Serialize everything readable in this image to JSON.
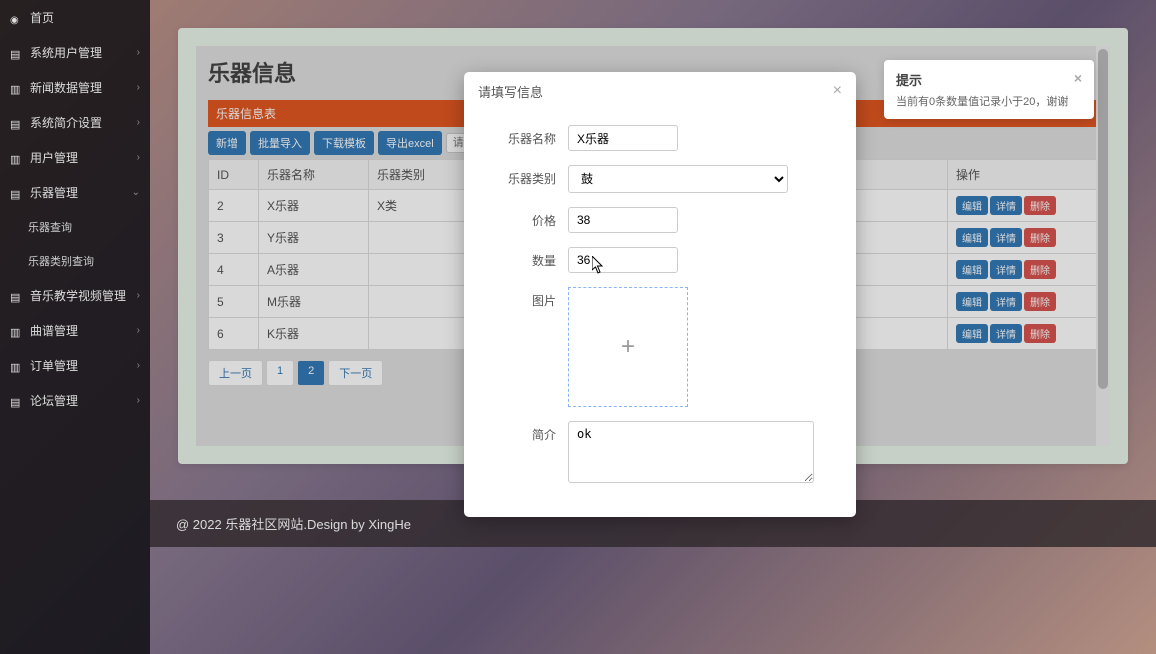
{
  "sidebar": {
    "items": [
      {
        "label": "首页",
        "icon": "dashboard",
        "expandable": false
      },
      {
        "label": "系统用户管理",
        "icon": "list",
        "expandable": true
      },
      {
        "label": "新闻数据管理",
        "icon": "page",
        "expandable": true
      },
      {
        "label": "系统简介设置",
        "icon": "list",
        "expandable": true
      },
      {
        "label": "用户管理",
        "icon": "page",
        "expandable": true
      },
      {
        "label": "乐器管理",
        "icon": "list",
        "expandable": true,
        "open": true,
        "children": [
          {
            "label": "乐器查询"
          },
          {
            "label": "乐器类别查询"
          }
        ]
      },
      {
        "label": "音乐教学视频管理",
        "icon": "list",
        "expandable": true
      },
      {
        "label": "曲谱管理",
        "icon": "page",
        "expandable": true
      },
      {
        "label": "订单管理",
        "icon": "page",
        "expandable": true
      },
      {
        "label": "论坛管理",
        "icon": "list",
        "expandable": true
      }
    ]
  },
  "page": {
    "title": "乐器信息",
    "table_title": "乐器信息表"
  },
  "toolbar": {
    "add": "新增",
    "import": "批量导入",
    "template": "下载模板",
    "export": "导出excel",
    "search_placeholder": "请输入搜索内容"
  },
  "table": {
    "headers": [
      "ID",
      "乐器名称",
      "乐器类别",
      "操作"
    ],
    "rows": [
      {
        "id": "2",
        "name": "X乐器",
        "category": "X类"
      },
      {
        "id": "3",
        "name": "Y乐器",
        "category": ""
      },
      {
        "id": "4",
        "name": "A乐器",
        "category": ""
      },
      {
        "id": "5",
        "name": "M乐器",
        "category": ""
      },
      {
        "id": "6",
        "name": "K乐器",
        "category": ""
      }
    ],
    "actions": {
      "edit": "编辑",
      "detail": "详情",
      "delete": "删除"
    }
  },
  "pagination": {
    "prev": "上一页",
    "pages": [
      "1",
      "2"
    ],
    "active": "2",
    "next": "下一页"
  },
  "modal": {
    "title": "请填写信息",
    "fields": {
      "name_label": "乐器名称",
      "name_value": "X乐器",
      "category_label": "乐器类别",
      "category_value": "鼓",
      "price_label": "价格",
      "price_value": "38",
      "qty_label": "数量",
      "qty_value": "36",
      "image_label": "图片",
      "intro_label": "简介",
      "intro_value": "ok"
    }
  },
  "toast": {
    "title": "提示",
    "body": "当前有0条数量值记录小于20，谢谢"
  },
  "footer": {
    "text": "@ 2022 乐器社区网站.Design by XingHe"
  }
}
